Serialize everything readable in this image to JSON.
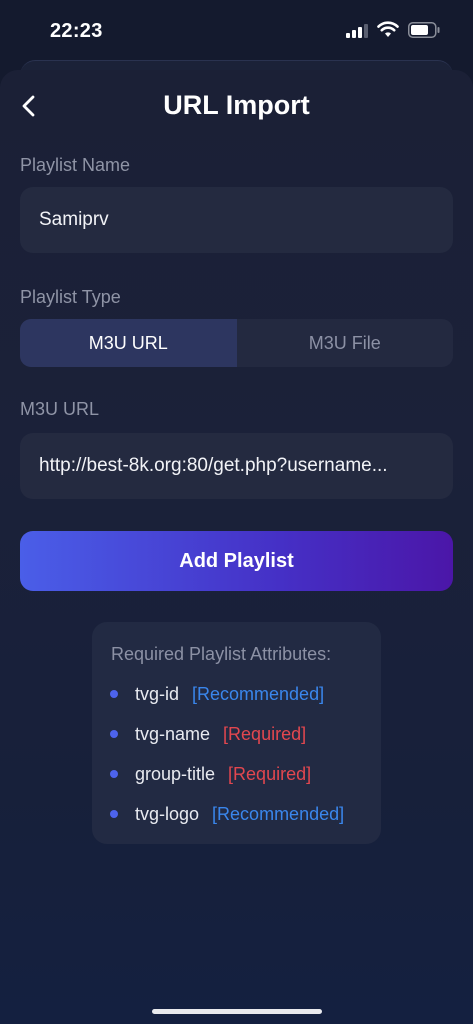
{
  "status_bar": {
    "time": "22:23"
  },
  "header": {
    "title": "URL Import"
  },
  "playlist_name": {
    "label": "Playlist Name",
    "value": "Samiprv"
  },
  "playlist_type": {
    "label": "Playlist Type",
    "options": [
      "M3U URL",
      "M3U File"
    ],
    "selected": "M3U URL"
  },
  "m3u_url": {
    "label": "M3U URL",
    "value": "http://best-8k.org:80/get.php?username..."
  },
  "add_button": {
    "label": "Add Playlist"
  },
  "attributes": {
    "title": "Required Playlist Attributes:",
    "items": [
      {
        "name": "tvg-id",
        "tag": "[Recommended]"
      },
      {
        "name": "tvg-name",
        "tag": "[Required]"
      },
      {
        "name": "group-title",
        "tag": "[Required]"
      },
      {
        "name": "tvg-logo",
        "tag": "[Recommended]"
      }
    ]
  },
  "colors": {
    "accent": "#4a5ee8",
    "recommended": "#3a86ec",
    "required": "#e2474f"
  }
}
